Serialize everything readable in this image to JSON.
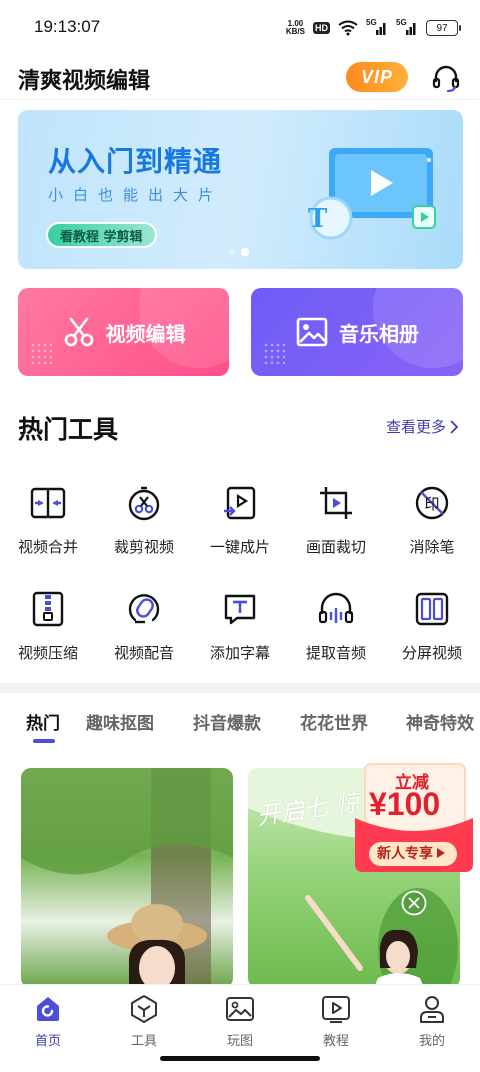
{
  "status_bar": {
    "time": "19:13:07",
    "net_speed_value": "1.00",
    "net_speed_unit": "KB/S",
    "hd": "HD",
    "signal_1": "5G",
    "signal_2": "5G",
    "battery": "97"
  },
  "header": {
    "title": "清爽视频编辑",
    "vip_label": "VIP",
    "icons": {
      "support": "headset-icon"
    }
  },
  "banner": {
    "title": "从入门到精通",
    "subtitle": "小白也能出大片",
    "cta": "看教程 学剪辑",
    "art_letter": "T",
    "carousel": {
      "count": 2,
      "active_index": 1
    }
  },
  "feature_cards": [
    {
      "label": "视频编辑",
      "icon": "scissors-icon"
    },
    {
      "label": "音乐相册",
      "icon": "photo-album-icon"
    }
  ],
  "hot_tools": {
    "title": "热门工具",
    "see_more": "查看更多",
    "items": [
      {
        "label": "视频合并",
        "icon": "merge-icon"
      },
      {
        "label": "裁剪视频",
        "icon": "clip-video-icon"
      },
      {
        "label": "一键成片",
        "icon": "one-click-video-icon"
      },
      {
        "label": "画面裁切",
        "icon": "crop-icon"
      },
      {
        "label": "消除笔",
        "icon": "remove-watermark-icon"
      },
      {
        "label": "视频压缩",
        "icon": "compress-icon"
      },
      {
        "label": "视频配音",
        "icon": "voiceover-icon"
      },
      {
        "label": "添加字幕",
        "icon": "subtitle-icon"
      },
      {
        "label": "提取音频",
        "icon": "extract-audio-icon"
      },
      {
        "label": "分屏视频",
        "icon": "split-screen-icon"
      }
    ]
  },
  "category_tabs": {
    "active_index": 0,
    "items": [
      "热门",
      "趣味抠图",
      "抖音爆款",
      "花花世界",
      "神奇特效"
    ]
  },
  "thumbnails": [
    {
      "caption": ""
    },
    {
      "caption": "开启七 惊喜纟"
    }
  ],
  "promo": {
    "label": "立减",
    "amount": "¥100",
    "cta": "新人专享"
  },
  "bottom_nav": {
    "active_index": 0,
    "items": [
      {
        "label": "首页",
        "icon": "home-icon"
      },
      {
        "label": "工具",
        "icon": "tools-icon"
      },
      {
        "label": "玩图",
        "icon": "image-icon"
      },
      {
        "label": "教程",
        "icon": "tutorial-icon"
      },
      {
        "label": "我的",
        "icon": "profile-icon"
      }
    ]
  },
  "colors": {
    "accent": "#3b3fb0",
    "vip": "#ff8a1f",
    "video_card": "#ff5f92",
    "music_card": "#7a5ff7",
    "banner_title": "#1778e0"
  }
}
